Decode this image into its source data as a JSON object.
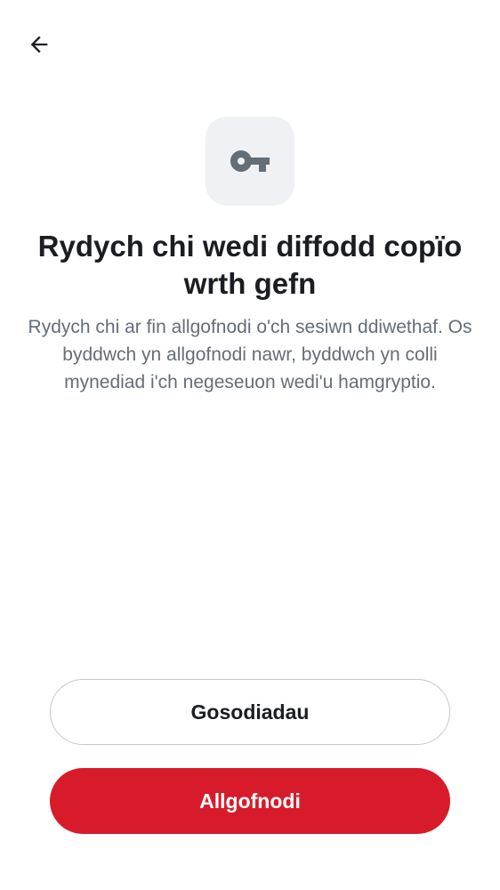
{
  "header": {
    "back_icon": "arrow-left-icon"
  },
  "hero": {
    "icon": "key-icon",
    "icon_color": "#656d77",
    "tile_color": "#eff1f5"
  },
  "dialog": {
    "title": "Rydych chi wedi diffodd copïo wrth gefn",
    "description": "Rydych chi ar fin allgofnodi o'ch sesiwn ddiwethaf. Os byddwch yn allgofnodi nawr, byddwch yn colli mynediad i'ch negeseuon wedi'u hamgryptio."
  },
  "actions": {
    "settings_label": "Gosodiadau",
    "signout_label": "Allgofnodi",
    "primary_color": "#d71b2a"
  }
}
